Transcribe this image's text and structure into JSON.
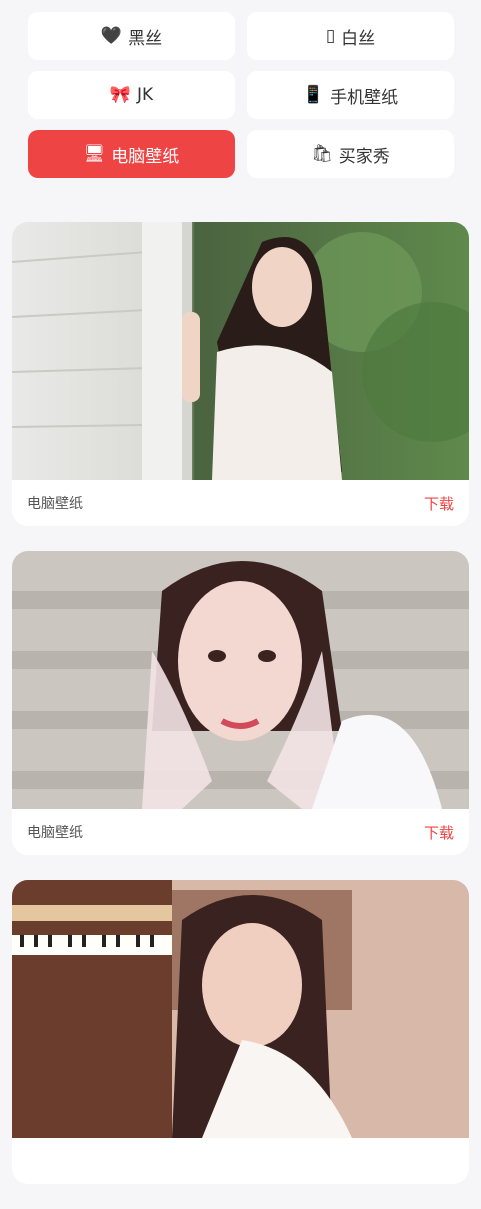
{
  "categories": [
    {
      "icon": "black-heart-icon",
      "glyph": "🖤",
      "label": "黑丝"
    },
    {
      "icon": "white-box-icon",
      "glyph": "▯",
      "label": "白丝"
    },
    {
      "icon": "ribbon-icon",
      "glyph": "🎀",
      "label": "JK"
    },
    {
      "icon": "mobile-phone-icon",
      "glyph": "📱",
      "label": "手机壁纸"
    },
    {
      "icon": "computer-icon",
      "glyph": "🖥",
      "label": "电脑壁纸",
      "active": true
    },
    {
      "icon": "shopping-bag-icon",
      "glyph": "🛍",
      "label": "买家秀"
    }
  ],
  "cards": [
    {
      "label": "电脑壁纸",
      "download": "下载"
    },
    {
      "label": "电脑壁纸",
      "download": "下载"
    },
    {
      "label": "",
      "download": ""
    }
  ],
  "colors": {
    "accent": "#ef4444",
    "background": "#f6f6f8"
  }
}
